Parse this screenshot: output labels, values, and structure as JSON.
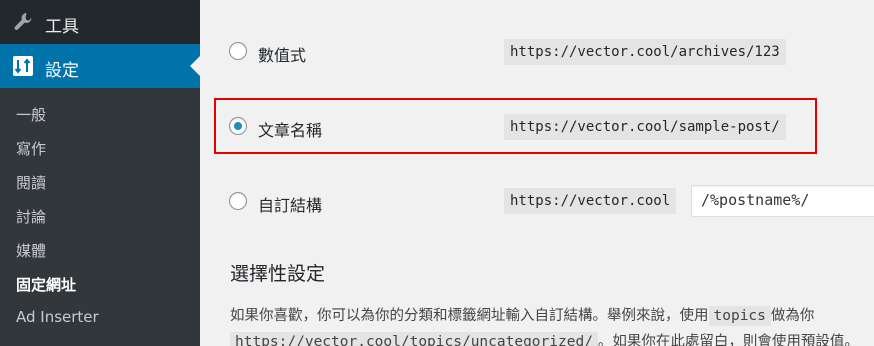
{
  "sidebar": {
    "tools_label": "工具",
    "settings_label": "設定",
    "submenu": [
      {
        "label": "一般",
        "current": false
      },
      {
        "label": "寫作",
        "current": false
      },
      {
        "label": "閱讀",
        "current": false
      },
      {
        "label": "討論",
        "current": false
      },
      {
        "label": "媒體",
        "current": false
      },
      {
        "label": "固定網址",
        "current": true
      },
      {
        "label": "Ad Inserter",
        "current": false
      }
    ]
  },
  "permalinks": {
    "options": [
      {
        "label": "數值式",
        "example": "https://vector.cool/archives/123",
        "checked": false
      },
      {
        "label": "文章名稱",
        "example": "https://vector.cool/sample-post/",
        "checked": true
      },
      {
        "label": "自訂結構",
        "example": "https://vector.cool",
        "checked": false
      }
    ],
    "custom_structure_value": "/%postname%/"
  },
  "optional": {
    "title": "選擇性設定",
    "line1_pre": "如果你喜歡，你可以為你的分類和標籤網址輸入自訂結構。舉例來說，使用",
    "line1_code": "topics",
    "line1_post": "做為你",
    "line2_code": "https://vector.cool/topics/uncategorized/",
    "line2_post": "。如果你在此處留白，則會使用預設值。"
  },
  "colors": {
    "sidebar_bg": "#23282d",
    "active_menu": "#0073aa",
    "highlight_border": "#e60000",
    "radio_dot": "#1e8cbe"
  }
}
